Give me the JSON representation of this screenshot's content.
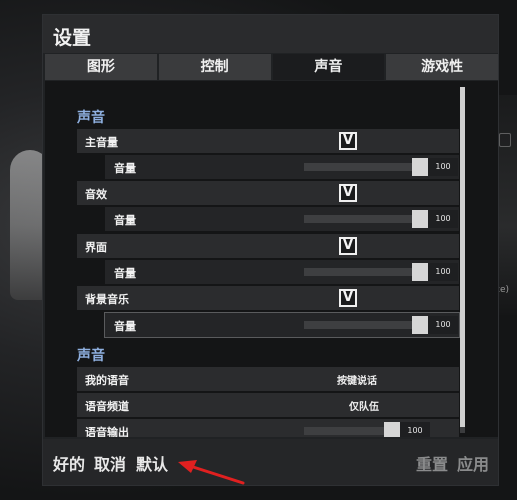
{
  "dialog": {
    "title": "设置"
  },
  "tabs": [
    {
      "label": "图形",
      "active": false
    },
    {
      "label": "控制",
      "active": false
    },
    {
      "label": "声音",
      "active": true
    },
    {
      "label": "游戏性",
      "active": false
    }
  ],
  "sections": {
    "sound_title": "声音",
    "voice_title": "声音"
  },
  "sound": {
    "master": {
      "label": "主音量",
      "checked": true,
      "check_glyph": "V",
      "volume_label": "音量",
      "volume_value": "100",
      "volume_fraction": 1.0
    },
    "effects": {
      "label": "音效",
      "checked": true,
      "check_glyph": "V",
      "volume_label": "音量",
      "volume_value": "100",
      "volume_fraction": 1.0
    },
    "ui": {
      "label": "界面",
      "checked": true,
      "check_glyph": "V",
      "volume_label": "音量",
      "volume_value": "100",
      "volume_fraction": 1.0
    },
    "music": {
      "label": "背景音乐",
      "checked": true,
      "check_glyph": "V",
      "volume_label": "音量",
      "volume_value": "100",
      "volume_fraction": 1.0
    }
  },
  "voice": {
    "my_voice": {
      "label": "我的语音",
      "value": "按键说话"
    },
    "channel": {
      "label": "语音频道",
      "value": "仅队伍"
    },
    "output": {
      "label": "语音输出",
      "value": "100",
      "fraction": 1.0
    }
  },
  "footer": {
    "ok": "好的",
    "cancel": "取消",
    "default": "默认",
    "reset": "重置",
    "apply": "应用"
  },
  "colors": {
    "section_title": "#8fb0e0",
    "annotation_arrow": "#e02020",
    "disabled_text": "#8a8b8c"
  }
}
